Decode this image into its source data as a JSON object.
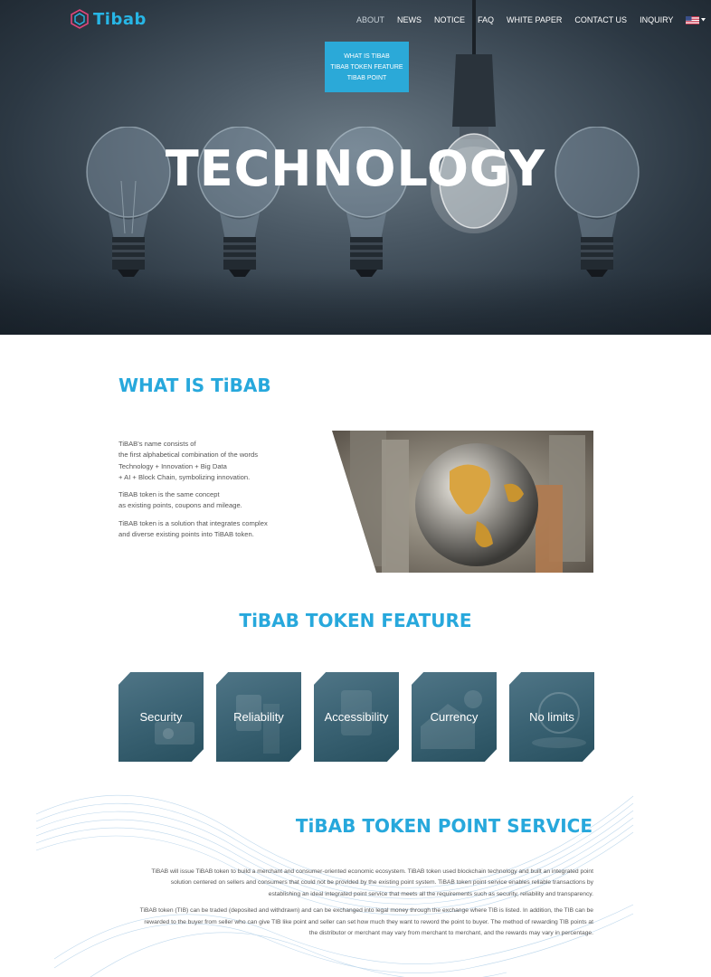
{
  "header": {
    "logo_text": "Tibab",
    "nav": [
      "ABOUT",
      "NEWS",
      "NOTICE",
      "FAQ",
      "WHITE PAPER",
      "CONTACT US",
      "INQUIRY"
    ],
    "language_icon": "us-flag-icon",
    "dropdown": [
      "WHAT IS TiBAB",
      "TiBAB TOKEN FEATURE",
      "TiBAB POINT"
    ]
  },
  "hero": {
    "title": "TECHNOLOGY"
  },
  "what_is": {
    "heading": "WHAT IS TiBAB",
    "paragraphs": [
      [
        "TiBAB's name consists of",
        "the first alphabetical combination of the words",
        "Technology + Innovation + Big Data",
        "+ AI + Block Chain, symbolizing innovation."
      ],
      [
        "TiBAB token is the same concept",
        "as existing points, coupons and mileage."
      ],
      [
        "TiBAB token is a solution that integrates complex",
        "and diverse existing points into TiBAB token."
      ]
    ]
  },
  "features": {
    "heading": "TiBAB TOKEN FEATURE",
    "items": [
      "Security",
      "Reliability",
      "Accessibility",
      "Currency",
      "No limits"
    ]
  },
  "point_service": {
    "heading": "TiBAB TOKEN POINT SERVICE",
    "paragraphs": [
      [
        "TiBAB will issue TiBAB token to build a merchant and consumer-oriented economic ecosystem. TiBAB token used blockchain technology and built an integrated point",
        "solution centered on sellers and consumers that could not be provided by the existing point system. TiBAB token point service enables reliable transactions by",
        "establishing an ideal integrated point service that meets all the requirements such as security, reliability and transparency."
      ],
      [
        "TiBAB token (TIB) can be traded (deposited and withdrawn) and can be exchanged into legal money through the exchange where TIB is listed. In addition, the TIB can be",
        "rewarded to the buyer from seller who can give TIB like point and seller can set how much they want to reword the point to buyer. The method of rewarding TIB points at",
        "the distributor or merchant may vary from merchant to merchant, and the rewards may vary in percentage."
      ]
    ]
  },
  "colors": {
    "accent": "#27a8dc",
    "dropdown_bg": "#2ba9d8",
    "feature_tile": "#3a6273"
  }
}
